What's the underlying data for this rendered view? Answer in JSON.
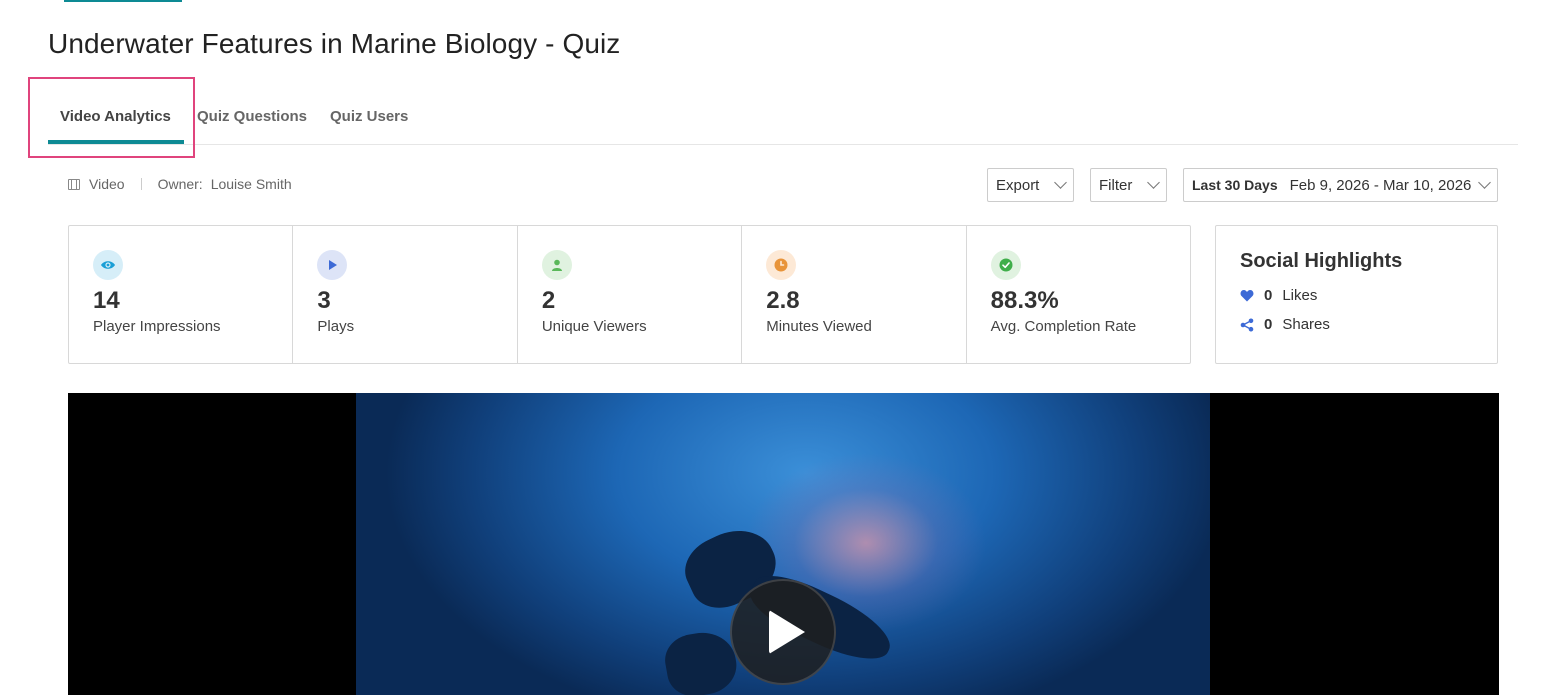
{
  "page": {
    "title": "Underwater Features in Marine Biology - Quiz"
  },
  "tabs": [
    {
      "label": "Video Analytics",
      "active": true
    },
    {
      "label": "Quiz Questions",
      "active": false
    },
    {
      "label": "Quiz Users",
      "active": false
    }
  ],
  "meta": {
    "type_label": "Video",
    "owner_label": "Owner:",
    "owner_name": "Louise Smith"
  },
  "controls": {
    "export_label": "Export",
    "filter_label": "Filter",
    "date_preset": "Last 30 Days",
    "date_range": "Feb 9, 2026 - Mar 10, 2026"
  },
  "stats": [
    {
      "icon": "eye-icon",
      "value": "14",
      "label": "Player Impressions",
      "icon_bg": "#d6eef8",
      "icon_color": "#1a9fd6"
    },
    {
      "icon": "play-icon",
      "value": "3",
      "label": "Plays",
      "icon_bg": "#dde4f7",
      "icon_color": "#3d6ad6"
    },
    {
      "icon": "user-icon",
      "value": "2",
      "label": "Unique Viewers",
      "icon_bg": "#e0f2e0",
      "icon_color": "#5ab85a"
    },
    {
      "icon": "clock-icon",
      "value": "2.8",
      "label": "Minutes Viewed",
      "icon_bg": "#fde9d6",
      "icon_color": "#e8943a"
    },
    {
      "icon": "check-icon",
      "value": "88.3%",
      "label": "Avg. Completion Rate",
      "icon_bg": "#e0f2e0",
      "icon_color": "#3fae4a"
    }
  ],
  "social": {
    "title": "Social Highlights",
    "likes_count": "0",
    "likes_label": "Likes",
    "shares_count": "0",
    "shares_label": "Shares",
    "accent": "#3d6ad6"
  },
  "colors": {
    "accent": "#0d8a94",
    "highlight": "#e0447d"
  }
}
